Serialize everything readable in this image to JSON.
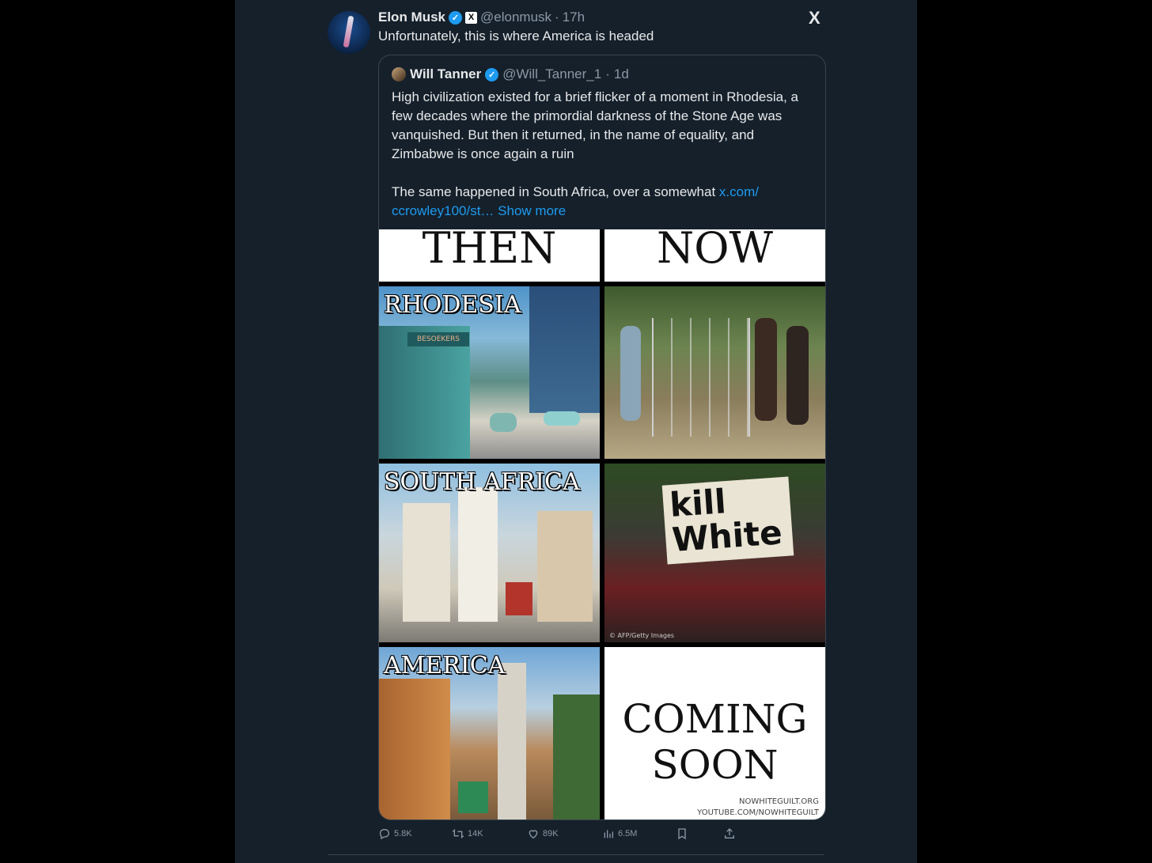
{
  "tweet": {
    "author_name": "Elon Musk",
    "handle": "@elonmusk",
    "time": "17h",
    "affiliate_badge": "X",
    "text": "Unfortunately, this is where America is headed",
    "x_logo": "X"
  },
  "quote": {
    "author_name": "Will Tanner",
    "handle": "@Will_Tanner_1",
    "time": "1d",
    "para1": "High civilization existed for a brief flicker of a moment in Rhodesia, a few decades where the primordial darkness of the Stone Age was vanquished. But then it returned, in the name of equality, and Zimbabwe is once again a ruin",
    "para2_text": "The same happened in South Africa, over a somewhat ",
    "para2_link1": "x.com/",
    "para2_link2": "ccrowley100/st…",
    "show_more": "Show more"
  },
  "meme": {
    "then_label": "THEN",
    "now_label": "NOW",
    "row1_label": "RHODESIA",
    "row1_shop_sign": "BESOEKERS",
    "row2_label": "SOUTH AFRICA",
    "row2_sign_line1": "kill",
    "row2_sign_line2": "White",
    "row2_credit": "© AFP/Getty Images",
    "row3_label": "AMERICA",
    "coming_line1": "COMING",
    "coming_line2": "SOON",
    "credit_line1": "NOWHITEGUILT.ORG",
    "credit_line2": "YOUTUBE.COM/NOWHITEGUILT"
  },
  "actions": {
    "replies": "5.8K",
    "reposts": "14K",
    "likes": "89K",
    "views": "6.5M"
  },
  "colors": {
    "panel_bg": "#15202b",
    "accent": "#1d9bf0",
    "muted": "#8b98a5",
    "border": "#38444d"
  }
}
